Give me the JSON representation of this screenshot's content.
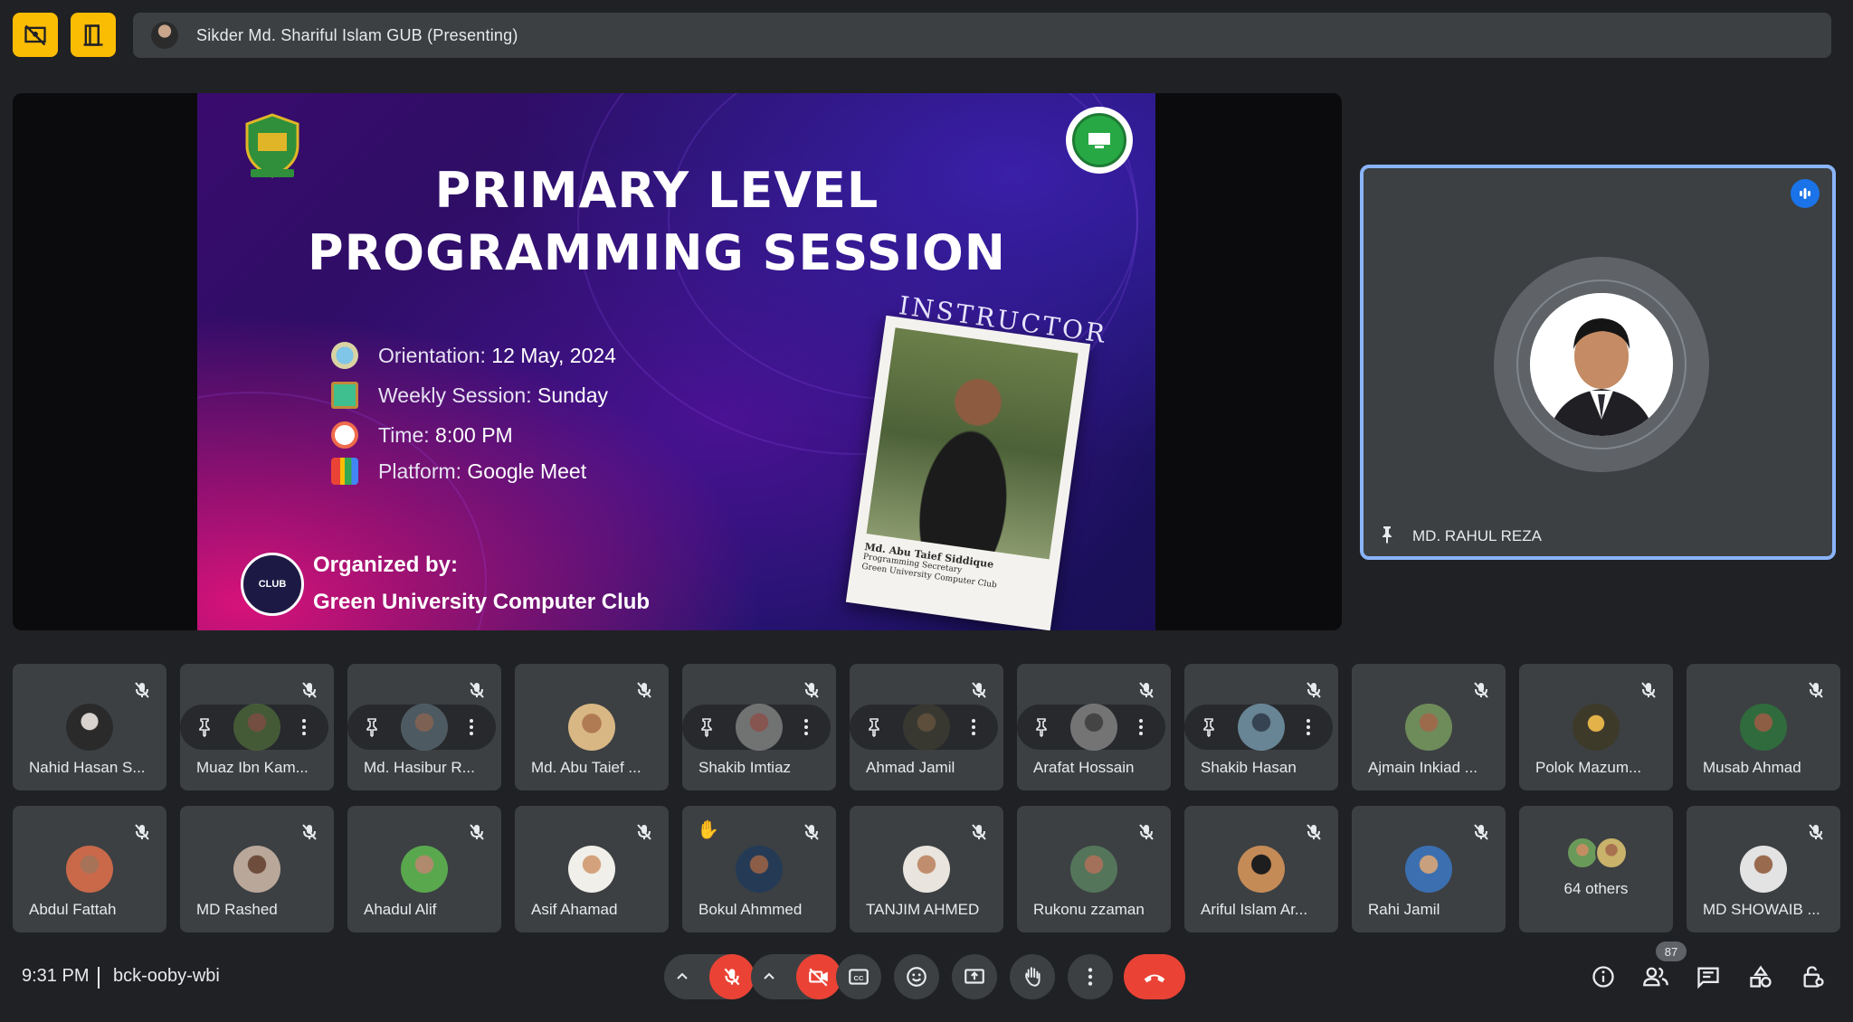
{
  "top_bar": {
    "presenting_label": "Sikder Md. Shariful Islam GUB (Presenting)"
  },
  "slide": {
    "title_line1": "PRIMARY LEVEL",
    "title_line2": "PROGRAMMING SESSION",
    "instructor_label": "INSTRUCTOR",
    "details": [
      {
        "label": "Orientation:",
        "value": "12 May, 2024"
      },
      {
        "label": "Weekly Session:",
        "value": "Sunday"
      },
      {
        "label": "Time:",
        "value": "8:00 PM"
      },
      {
        "label": "Platform:",
        "value": "Google Meet"
      }
    ],
    "organized_by": "Organized by:",
    "organizer": "Green University Computer Club",
    "instructor_name": "Md. Abu Taief Siddique",
    "instructor_role": "Programming Secretary",
    "instructor_org": "Green University Computer Club",
    "club_logo_text": "CLUB"
  },
  "spotlight": {
    "name": "MD. RAHUL REZA"
  },
  "participants_row1": [
    {
      "name": "Nahid Hasan S..."
    },
    {
      "name": "Muaz Ibn Kam..."
    },
    {
      "name": "Md. Hasibur R..."
    },
    {
      "name": "Md. Abu Taief ..."
    },
    {
      "name": "Shakib Imtiaz"
    },
    {
      "name": "Ahmad Jamil"
    },
    {
      "name": "Arafat Hossain"
    },
    {
      "name": "Shakib Hasan"
    },
    {
      "name": "Ajmain Inkiad ..."
    },
    {
      "name": "Polok Mazum..."
    },
    {
      "name": "Musab Ahmad"
    }
  ],
  "participants_row2": [
    {
      "name": "Abdul Fattah"
    },
    {
      "name": "MD Rashed"
    },
    {
      "name": "Ahadul Alif"
    },
    {
      "name": "Asif Ahamad"
    },
    {
      "name": "Bokul Ahmmed"
    },
    {
      "name": "TANJIM AHMED"
    },
    {
      "name": "Rukonu zzaman"
    },
    {
      "name": "Ariful Islam Ar..."
    },
    {
      "name": "Rahi Jamil"
    },
    {
      "name": "64 others"
    },
    {
      "name": "MD SHOWAIB ..."
    }
  ],
  "bottom_bar": {
    "time": "9:31 PM",
    "meeting_code": "bck-ooby-wbi",
    "participant_count": "87"
  },
  "colors": {
    "background": "#202124",
    "tile": "#3c4043",
    "accent_yellow": "#fbbc04",
    "danger_red": "#ea4335",
    "spotlight_border": "#8ab4f8",
    "speaking_blue": "#1a73e8"
  },
  "icons": {
    "top_left_1": "hide-self-view-icon",
    "top_left_2": "exit-presentation-icon",
    "controls": [
      "chevron-up-icon",
      "mic-off-icon",
      "chevron-up-icon",
      "camera-off-icon",
      "captions-icon",
      "emoji-icon",
      "present-screen-icon",
      "raise-hand-icon",
      "more-options-icon",
      "end-call-icon"
    ],
    "right_controls": [
      "info-icon",
      "people-icon",
      "chat-icon",
      "activities-icon",
      "host-controls-icon"
    ]
  }
}
